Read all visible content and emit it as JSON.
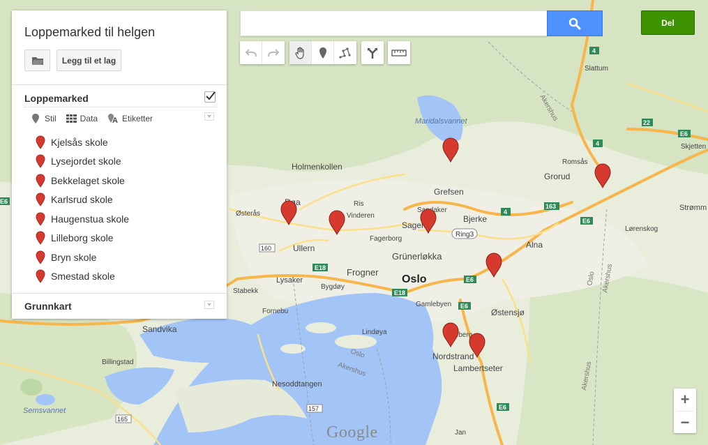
{
  "map_title": "Loppemarked til helgen",
  "add_layer_label": "Legg til et lag",
  "layer": {
    "name": "Loppemarked",
    "checked": true,
    "tools": [
      {
        "label": "Stil",
        "icon": "style-pin-icon"
      },
      {
        "label": "Data",
        "icon": "data-grid-icon"
      },
      {
        "label": "Etiketter",
        "icon": "label-icon"
      }
    ],
    "places": [
      {
        "name": "Kjelsås skole"
      },
      {
        "name": "Lysejordet skole"
      },
      {
        "name": "Bekkelaget skole"
      },
      {
        "name": "Karlsrud skole"
      },
      {
        "name": "Haugenstua skole"
      },
      {
        "name": "Lilleborg skole"
      },
      {
        "name": "Bryn skole"
      },
      {
        "name": "Smestad skole"
      }
    ]
  },
  "basemap_label": "Grunnkart",
  "search": {
    "value": "",
    "placeholder": ""
  },
  "share_label": "Del",
  "toolbar": [
    "undo-icon",
    "redo-icon",
    "hand-icon",
    "marker-icon",
    "line-icon",
    "directions-icon",
    "ruler-icon"
  ],
  "zoom": {
    "in": "+",
    "out": "−"
  },
  "attribution": "Google",
  "colors": {
    "marker": "#d63a2f",
    "water": "#a3c4f7",
    "land": "#e8eddc",
    "search_button": "#4d90fe",
    "share_button": "#3d9400"
  },
  "map_labels": {
    "holmenkollen": "Holmenkollen",
    "maridalsvannet": "Maridalsvannet",
    "grefsen": "Grefsen",
    "sandaker": "Sandaker",
    "sagene": "Sagene",
    "bjerke": "Bjerke",
    "ring3": "Ring3",
    "grunerlokka": "Grünerløkka",
    "oslo": "Oslo",
    "frogner": "Frogner",
    "ullern": "Ullern",
    "lysaker": "Lysaker",
    "bygdoy": "Bygdøy",
    "gamlebyen": "Gamlebyen",
    "alna": "Alna",
    "grorud": "Grorud",
    "romsas": "Romsås",
    "slattum": "Slattum",
    "skjetten": "Skjetten",
    "strommen": "Strømm",
    "lorenskog": "Lørenskog",
    "ostensjo": "Østensjø",
    "nordstrand": "Nordstrand",
    "lambertseter": "Lambertseter",
    "sandvika": "Sandvika",
    "billingstad": "Billingstad",
    "semsvannet": "Semsvannet",
    "nesoddtangen": "Nesoddtangen",
    "fornebu": "Fornebu",
    "stabekk": "Stabekk",
    "osteras": "Østerås",
    "roa": "Røa",
    "vinderen": "Vinderen",
    "ris": "Ris",
    "fagerborg": "Fagerborg",
    "lindoya": "Lindøya",
    "akershus1": "Akershus",
    "akershus2": "Akershus",
    "akershus3": "Akershus",
    "akershus4": "Akershus",
    "oslo_w1": "Oslo",
    "oslo_w2": "Oslo",
    "sign_e18a": "E18",
    "sign_e18b": "E18",
    "sign_e6a": "E6",
    "sign_e6b": "E6",
    "sign_e6c": "E6",
    "sign_e6d": "E6",
    "sign_e6e": "E6",
    "sign_4a": "4",
    "sign_4b": "4",
    "sign_4c": "4",
    "sign_163": "163",
    "sign_160": "160",
    "sign_157": "157",
    "sign_165": "165",
    "sign_22": "22",
    "sign_e6w": "E6",
    "ekeberg": "Ekeberg",
    "jan": "Jan"
  }
}
